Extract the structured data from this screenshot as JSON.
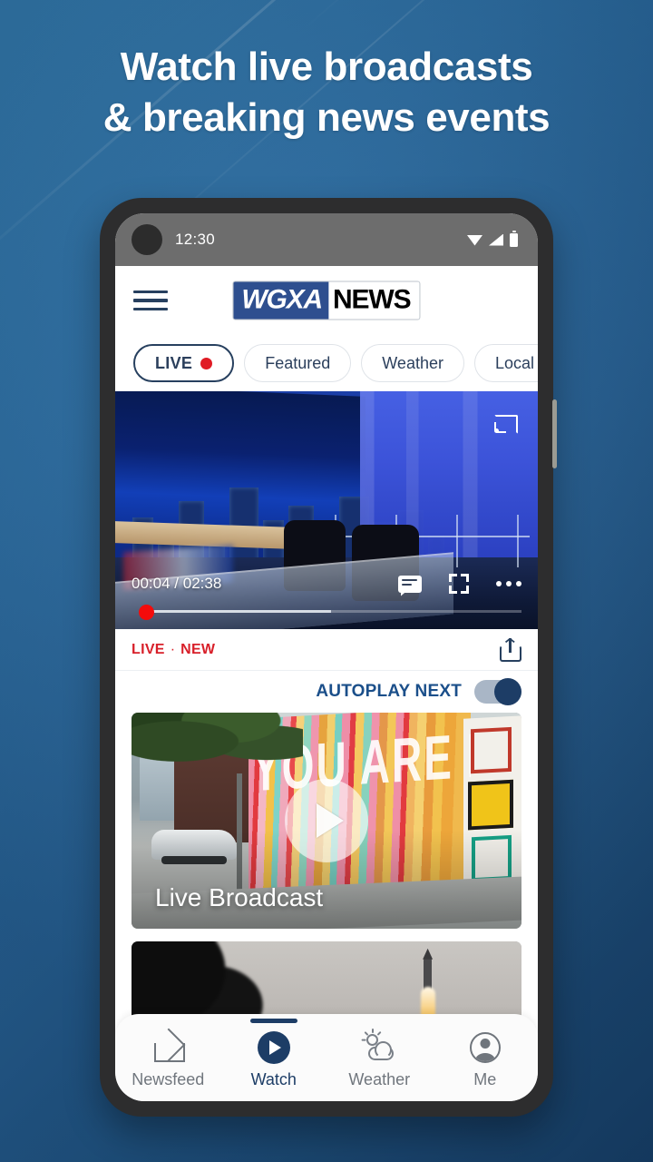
{
  "promo": {
    "headline_line1": "Watch live broadcasts",
    "headline_line2": "& breaking news events",
    "bg_color_top": "#3279ad",
    "bg_color_bottom": "#17406a"
  },
  "status_bar": {
    "time": "12:30",
    "wifi_icon": "wifi-icon",
    "signal_icon": "signal-icon",
    "battery_icon": "battery-icon"
  },
  "header": {
    "menu_icon": "hamburger-menu-icon",
    "brand_primary": "WGXA",
    "brand_secondary": "NEWS",
    "brand_primary_bg": "#2e4f8f"
  },
  "tabs": [
    {
      "label": "LIVE",
      "active": true,
      "has_live_dot": true
    },
    {
      "label": "Featured",
      "active": false,
      "has_live_dot": false
    },
    {
      "label": "Weather",
      "active": false,
      "has_live_dot": false
    },
    {
      "label": "Local",
      "active": false,
      "has_live_dot": false
    },
    {
      "label": "",
      "active": false,
      "has_live_dot": false
    }
  ],
  "player": {
    "current_time": "00:04",
    "separator": "/",
    "duration": "02:38",
    "cast_icon": "cast-icon",
    "captions_icon": "closed-captions-icon",
    "fullscreen_icon": "fullscreen-icon",
    "more_icon": "more-options-icon",
    "progress_percent": 3,
    "buffer_percent": 47,
    "scrubber_color": "#f40b0b"
  },
  "meta": {
    "live_badge": "LIVE",
    "separator": "·",
    "new_badge": "NEW",
    "badge_color": "#d8202a",
    "share_icon": "share-icon"
  },
  "autoplay": {
    "label": "AUTOPLAY NEXT",
    "enabled": true,
    "label_color": "#1b4f8a",
    "knob_color": "#1d3d66"
  },
  "cards": [
    {
      "caption": "Live Broadcast",
      "mural_text": "YOU ARE BEAUTIFUL",
      "play_icon": "play-button-icon"
    },
    {
      "caption": "",
      "scene": "rocket-launch"
    }
  ],
  "bottom_nav": [
    {
      "label": "Newsfeed",
      "icon": "home-icon",
      "active": false
    },
    {
      "label": "Watch",
      "icon": "play-circle-icon",
      "active": true
    },
    {
      "label": "Weather",
      "icon": "sun-cloud-icon",
      "active": false
    },
    {
      "label": "Me",
      "icon": "person-icon",
      "active": false
    }
  ]
}
